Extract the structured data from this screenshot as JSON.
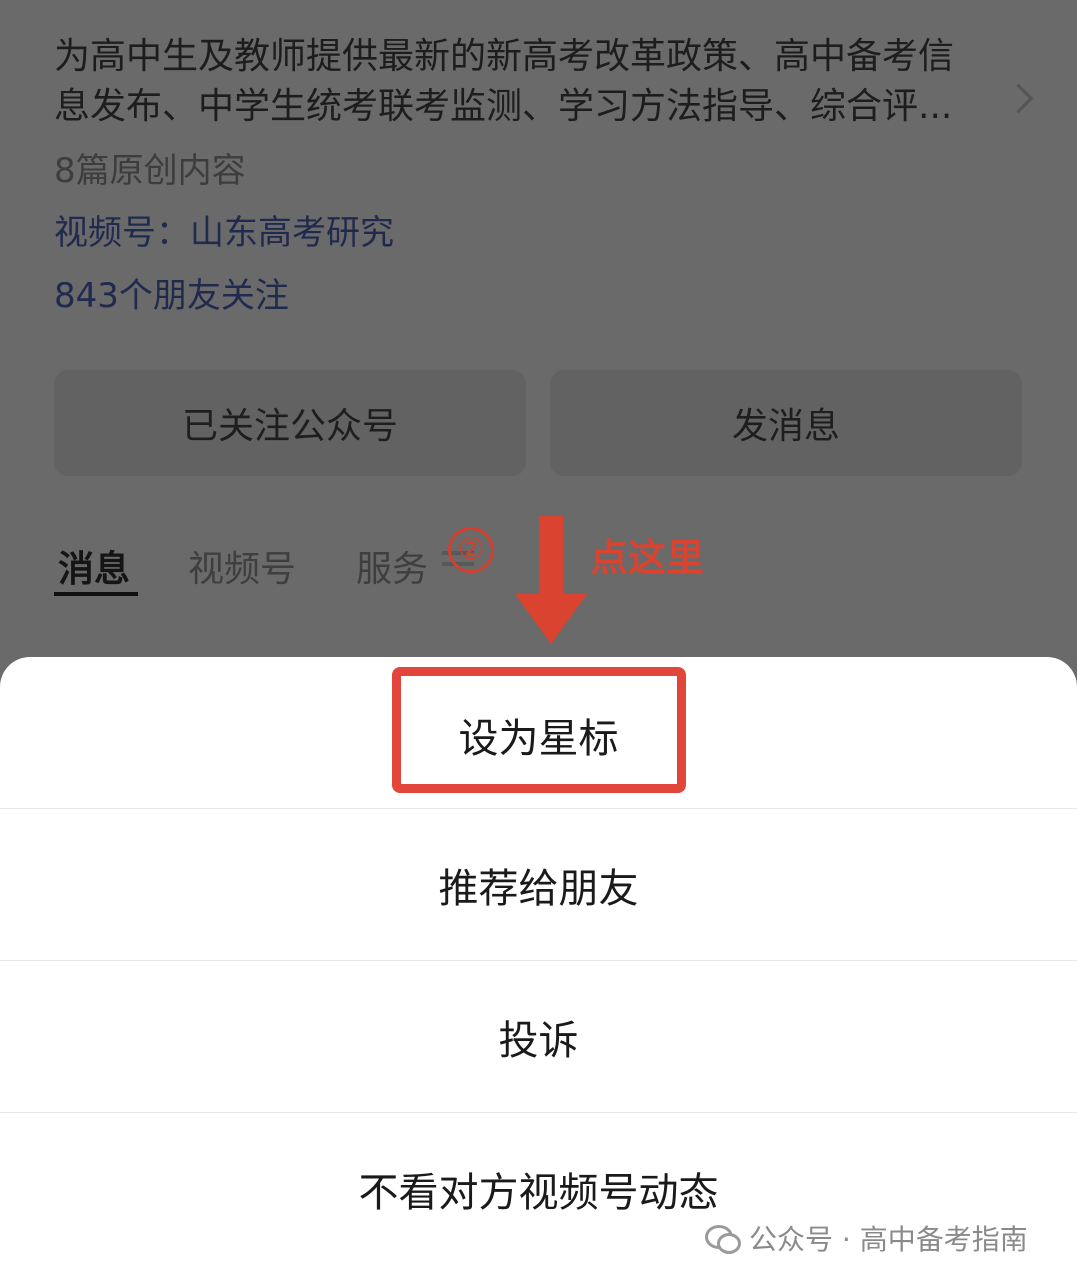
{
  "profile": {
    "description_lines": [
      "为高中生及教师提供最新的新高考改革政策、高中备考信",
      "息发布、中学生统考联考监测、学习方法指导、综合评..."
    ],
    "original_count": "8篇原创内容",
    "video_channel": "视频号：山东高考研究",
    "friends_following": "843个朋友关注"
  },
  "actions": {
    "followed": "已关注公众号",
    "message": "发消息"
  },
  "tabs": [
    {
      "label": "消息",
      "active": true
    },
    {
      "label": "视频号",
      "active": false
    },
    {
      "label": "服务",
      "active": false
    }
  ],
  "annotation": {
    "step_number": "②",
    "callout": "点这里",
    "color": "#d9432f"
  },
  "sheet": {
    "items": [
      {
        "label": "设为星标",
        "highlighted": true
      },
      {
        "label": "推荐给朋友"
      },
      {
        "label": "投诉"
      },
      {
        "label": "不看对方视频号动态"
      }
    ]
  },
  "watermark": {
    "text": "公众号 · 高中备考指南",
    "icon": "wechat-icon"
  }
}
